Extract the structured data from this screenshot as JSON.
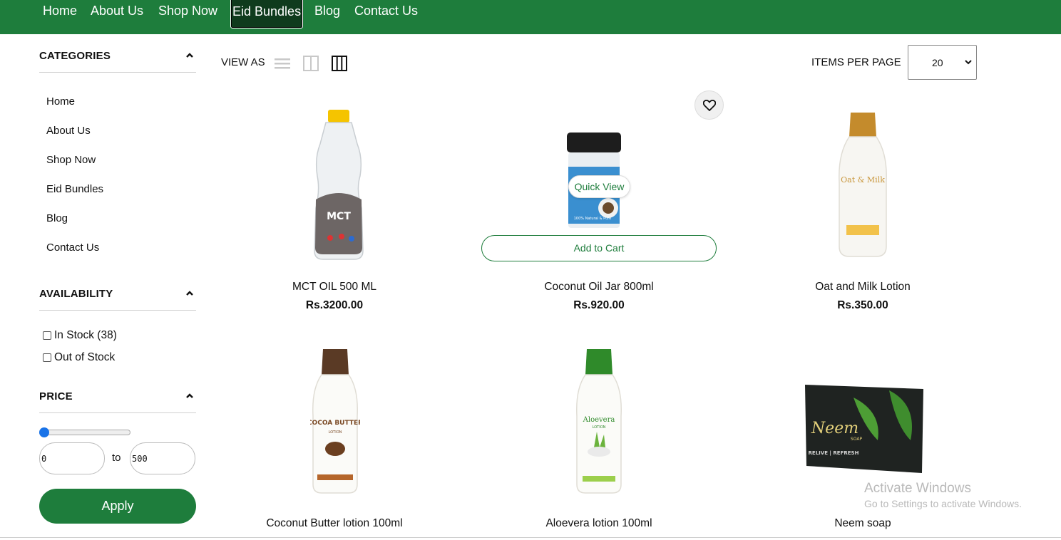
{
  "nav": {
    "items": [
      "Home",
      "About Us",
      "Shop Now",
      "Eid Bundles",
      "Blog",
      "Contact Us"
    ],
    "active": "Eid Bundles"
  },
  "sidebar": {
    "categories_title": "CATEGORIES",
    "categories": [
      "Home",
      "About Us",
      "Shop Now",
      "Eid Bundles",
      "Blog",
      "Contact Us"
    ],
    "availability_title": "AVAILABILITY",
    "availability": [
      {
        "label": "In Stock (38)",
        "checked": false
      },
      {
        "label": "Out of Stock",
        "checked": false
      }
    ],
    "price_title": "PRICE",
    "price_min": "0",
    "price_to": "to",
    "price_max": "500",
    "apply_label": "Apply"
  },
  "toolbar": {
    "view_as": "VIEW AS",
    "items_per_page_label": "ITEMS PER PAGE",
    "items_per_page_value": "20"
  },
  "products": [
    {
      "name": "MCT OIL 500 ML",
      "price": "Rs.3200.00"
    },
    {
      "name": "Coconut Oil Jar 800ml",
      "price": "Rs.920.00"
    },
    {
      "name": "Oat and Milk Lotion",
      "price": "Rs.350.00"
    },
    {
      "name": "Coconut Butter lotion 100ml",
      "price": ""
    },
    {
      "name": "Aloevera lotion 100ml",
      "price": ""
    },
    {
      "name": "Neem soap",
      "price": ""
    }
  ],
  "hover_actions": {
    "quick_view": "Quick View",
    "add_to_cart": "Add to Cart"
  },
  "product_label_text": {
    "mct": "MCT",
    "coconut": "100% Natural & Pure",
    "oat": "Oat & Milk",
    "cocoa": "COCOA BUTTER",
    "cocoa_sub": "LOTION",
    "aloe": "Aloevera",
    "aloe_sub": "LOTION",
    "neem": "Neem",
    "neem_sub": "SOAP",
    "neem_tag": "RELIVE | REFRESH"
  },
  "watermark": {
    "line1": "Activate Windows",
    "line2": "Go to Settings to activate Windows."
  },
  "colors": {
    "brand_green": "#1e7d3c",
    "slider_blue": "#1973e8"
  }
}
